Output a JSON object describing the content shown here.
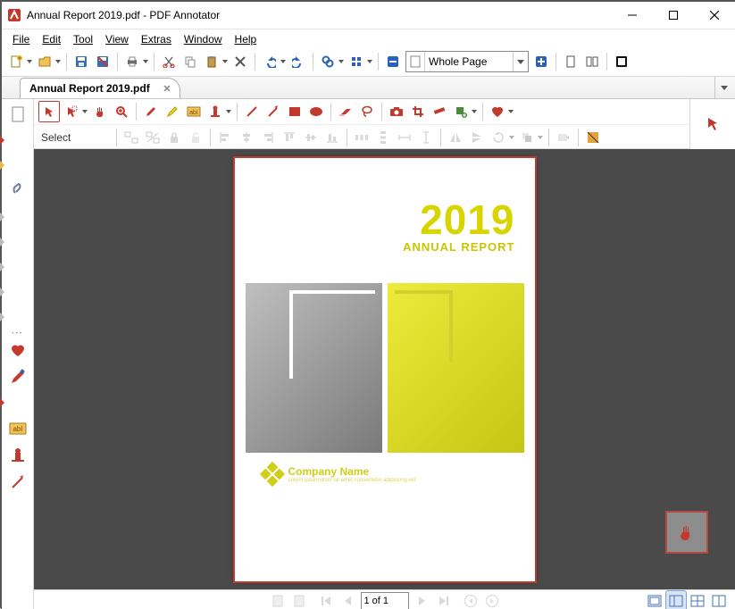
{
  "window": {
    "title": "Annual Report 2019.pdf - PDF Annotator"
  },
  "menu": {
    "items": [
      "File",
      "Edit",
      "Tool",
      "View",
      "Extras",
      "Window",
      "Help"
    ]
  },
  "toolbar": {
    "zoom_label": "Whole Page"
  },
  "tabs": {
    "items": [
      {
        "label": "Annual Report 2019.pdf"
      }
    ]
  },
  "annot": {
    "mode_label": "Select"
  },
  "nav": {
    "page_field": "1 of 1"
  },
  "document": {
    "year": "2019",
    "subtitle": "ANNUAL REPORT",
    "company_name": "Company Name",
    "company_tagline": "Lorem ipsum dolor sit amet consectetur adipiscing elit"
  },
  "colors": {
    "accent": "#c23a2e",
    "blue": "#2a62b8",
    "yellow": "#d7d400",
    "toolbar_gray": "#707070"
  }
}
